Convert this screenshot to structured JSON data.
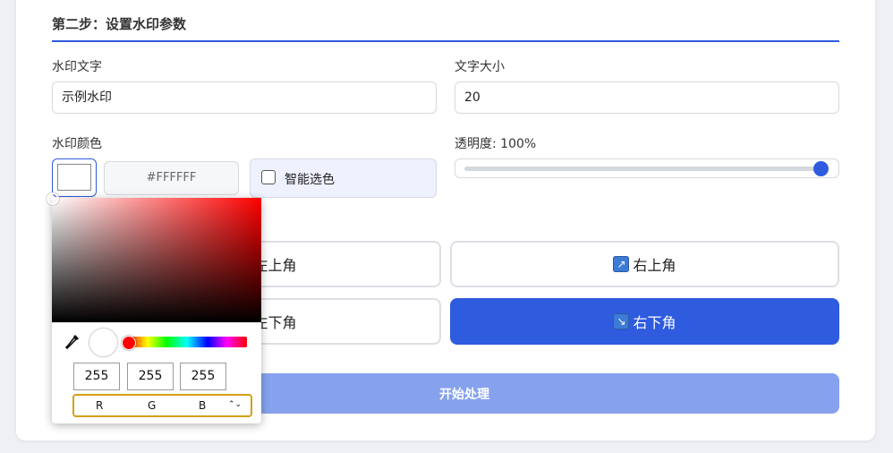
{
  "step": {
    "title": "第二步：设置水印参数"
  },
  "watermark_text": {
    "label": "水印文字",
    "value": "示例水印"
  },
  "font_size": {
    "label": "文字大小",
    "value": "20"
  },
  "color": {
    "label": "水印颜色",
    "hex": "#FFFFFF",
    "smart_label": "智能选色",
    "smart_checked": false
  },
  "opacity": {
    "label": "透明度: 100%",
    "value_percent": 100
  },
  "positions": [
    {
      "label": "左上角",
      "icon": "arrow-up-left-icon",
      "active": false
    },
    {
      "label": "右上角",
      "icon": "arrow-up-right-icon",
      "active": false
    },
    {
      "label": "左下角",
      "icon": "arrow-down-left-icon",
      "active": false
    },
    {
      "label": "右下角",
      "icon": "arrow-down-right-icon",
      "active": true
    }
  ],
  "start_button": {
    "label": "开始处理"
  },
  "picker": {
    "r": "255",
    "g": "255",
    "b": "255",
    "mode_labels": [
      "R",
      "G",
      "B"
    ],
    "mode_toggle": "⌃⌄"
  },
  "colors": {
    "accent": "#2f5bdf",
    "start_button": "#86a2ee",
    "selector_outline": "#d4a017"
  }
}
